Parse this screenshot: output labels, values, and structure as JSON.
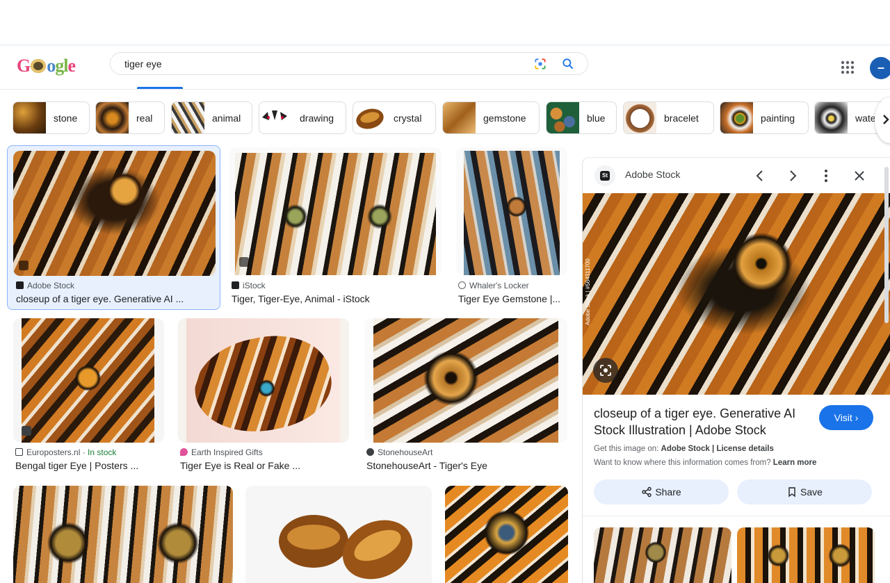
{
  "search": {
    "query": "tiger eye"
  },
  "logo": {
    "text": "Google"
  },
  "chips": [
    {
      "label": "stone"
    },
    {
      "label": "real"
    },
    {
      "label": "animal"
    },
    {
      "label": "drawing"
    },
    {
      "label": "crystal"
    },
    {
      "label": "gemstone"
    },
    {
      "label": "blue"
    },
    {
      "label": "bracelet"
    },
    {
      "label": "painting"
    },
    {
      "label": "wate"
    }
  ],
  "results": [
    {
      "source": "Adobe Stock",
      "title": "closeup of a tiger eye. Generative AI ..."
    },
    {
      "source": "iStock",
      "title": "Tiger, Tiger-Eye, Animal - iStock"
    },
    {
      "source": "Whaler's Locker",
      "title": "Tiger Eye Gemstone |..."
    },
    {
      "source": "Europosters.nl",
      "source_extra": "In stock",
      "title": "Bengal tiger Eye | Posters ..."
    },
    {
      "source": "Earth Inspired Gifts",
      "title": "Tiger Eye is Real or Fake ..."
    },
    {
      "source": "StonehouseArt",
      "title": "StonehouseArt - Tiger's Eye"
    }
  ],
  "panel": {
    "source_name": "Adobe Stock",
    "source_badge": "St",
    "image_watermark": "Adobe Stock | #564311700",
    "title": "closeup of a tiger eye. Generative AI Stock Illustration | Adobe Stock",
    "visit_label": "Visit",
    "get_image_prefix": "Get this image on: ",
    "get_image_source": "Adobe Stock",
    "separator": " | ",
    "license_label": "License details",
    "info_prefix": "Want to know where this information comes from? ",
    "learn_more": "Learn more",
    "share_label": "Share",
    "save_label": "Save"
  },
  "colors": {
    "accent": "#1a73e8",
    "selected_bg": "#e8f0fe",
    "in_stock": "#188038"
  }
}
